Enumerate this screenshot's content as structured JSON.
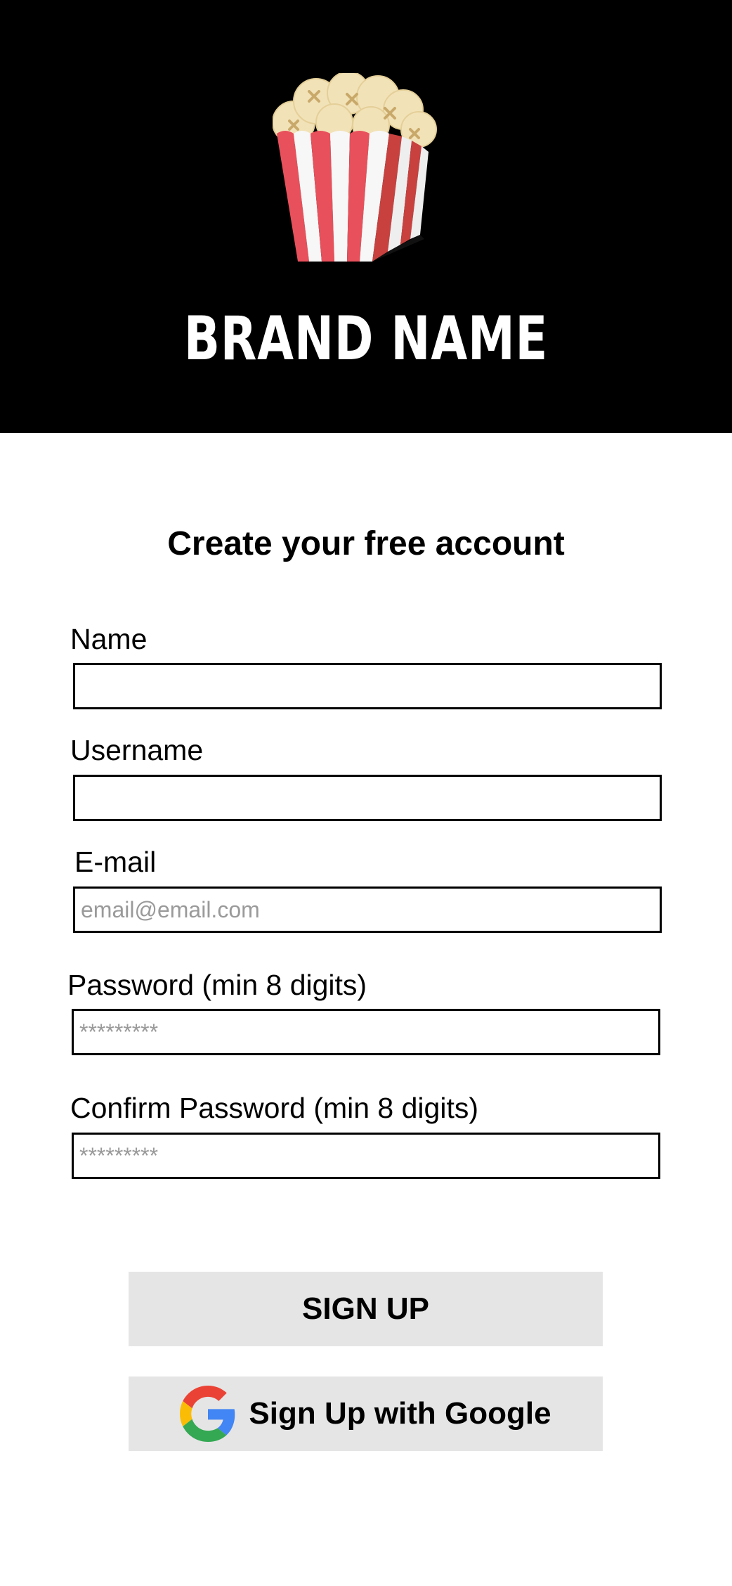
{
  "header": {
    "brand_name": "BRAND NAME",
    "logo_icon": "popcorn-icon",
    "background_color": "#000000",
    "brand_color": "#ffffff"
  },
  "form": {
    "title": "Create your free account",
    "fields": [
      {
        "label": "Name",
        "value": "",
        "placeholder": ""
      },
      {
        "label": "Username",
        "value": "",
        "placeholder": ""
      },
      {
        "label": "E-mail",
        "value": "",
        "placeholder": "email@email.com"
      },
      {
        "label": "Password (min 8 digits)",
        "value": "",
        "placeholder": "*********"
      },
      {
        "label": "Confirm Password (min 8 digits)",
        "value": "",
        "placeholder": "*********"
      }
    ]
  },
  "buttons": {
    "signup_label": "SIGN UP",
    "google_label": "Sign Up with Google",
    "google_icon": "google-g-icon",
    "button_color": "#e5e5e5"
  }
}
